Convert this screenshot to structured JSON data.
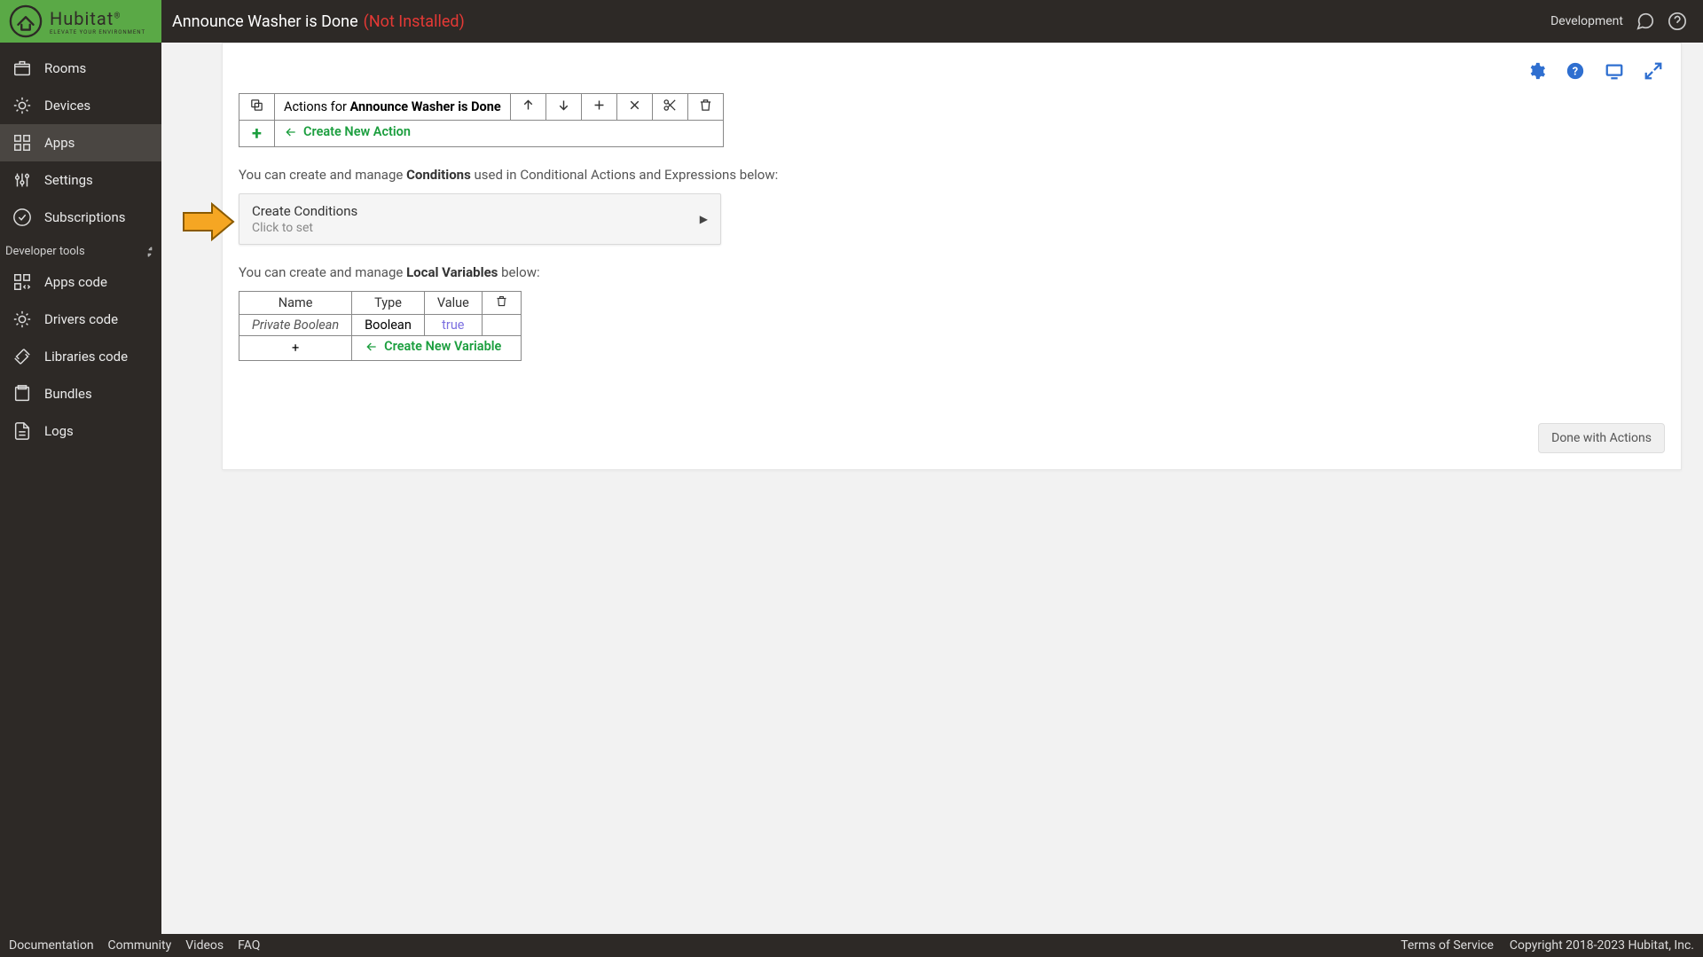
{
  "brand": {
    "name": "Hubitat",
    "tag": "ELEVATE YOUR ENVIRONMENT",
    "reg": "®"
  },
  "header": {
    "title": "Announce Washer is Done",
    "status": "(Not Installed)",
    "dev": "Development"
  },
  "sidebar": {
    "items": [
      {
        "label": "Rooms"
      },
      {
        "label": "Devices"
      },
      {
        "label": "Apps"
      },
      {
        "label": "Settings"
      },
      {
        "label": "Subscriptions"
      }
    ],
    "section": "Developer tools",
    "dev_items": [
      {
        "label": "Apps code"
      },
      {
        "label": "Drivers code"
      },
      {
        "label": "Libraries code"
      },
      {
        "label": "Bundles"
      },
      {
        "label": "Logs"
      }
    ]
  },
  "actions_bar": {
    "prefix": "Actions for ",
    "rule": "Announce Washer is Done",
    "create": "Create New Action"
  },
  "conditions": {
    "intro_a": "You can create and manage ",
    "intro_b": "Conditions",
    "intro_c": " used in Conditional Actions and Expressions below:",
    "title": "Create Conditions",
    "sub": "Click to set"
  },
  "vars": {
    "intro_a": "You can create and manage ",
    "intro_b": "Local Variables",
    "intro_c": " below:",
    "headers": {
      "name": "Name",
      "type": "Type",
      "value": "Value"
    },
    "row": {
      "name": "Private Boolean",
      "type": "Boolean",
      "value": "true"
    },
    "create": "Create New Variable"
  },
  "done": "Done with Actions",
  "footer": {
    "left": [
      "Documentation",
      "Community",
      "Videos",
      "FAQ"
    ],
    "right": [
      "Terms of Service",
      "Copyright 2018-2023 Hubitat, Inc."
    ]
  }
}
